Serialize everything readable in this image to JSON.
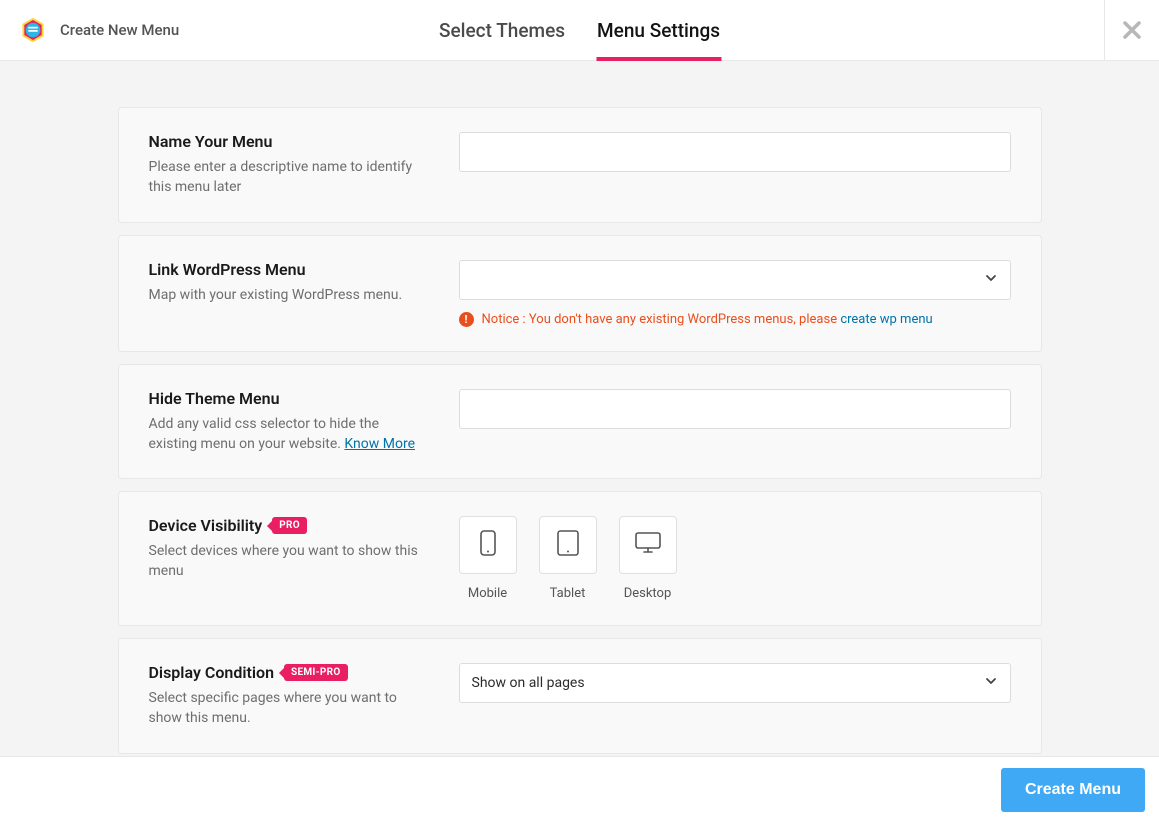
{
  "header": {
    "title": "Create New Menu",
    "tabs": [
      {
        "label": "Select Themes",
        "active": false
      },
      {
        "label": "Menu Settings",
        "active": true
      }
    ]
  },
  "sections": {
    "name": {
      "title": "Name Your Menu",
      "desc": "Please enter a descriptive name to identify this menu later",
      "value": ""
    },
    "link_wp": {
      "title": "Link WordPress Menu",
      "desc": "Map with your existing WordPress menu.",
      "selected": "",
      "notice_text": "Notice : You don't have any existing WordPress menus, please ",
      "notice_link": "create wp menu"
    },
    "hide_theme": {
      "title": "Hide Theme Menu",
      "desc": "Add any valid css selector to hide the existing menu on your website. ",
      "know_more": "Know More",
      "value": ""
    },
    "visibility": {
      "title": "Device Visibility",
      "badge": "PRO",
      "desc": "Select devices where you want to show this menu",
      "devices": [
        {
          "id": "mobile",
          "label": "Mobile"
        },
        {
          "id": "tablet",
          "label": "Tablet"
        },
        {
          "id": "desktop",
          "label": "Desktop"
        }
      ]
    },
    "display_condition": {
      "title": "Display Condition",
      "badge": "SEMI-PRO",
      "desc": "Select specific pages where you want to show this menu.",
      "selected": "Show on all pages"
    }
  },
  "footer": {
    "create_label": "Create Menu"
  },
  "colors": {
    "accent": "#e91e63",
    "primary_btn": "#3fa9f5",
    "link": "#0073aa",
    "error": "#e94f1d"
  }
}
